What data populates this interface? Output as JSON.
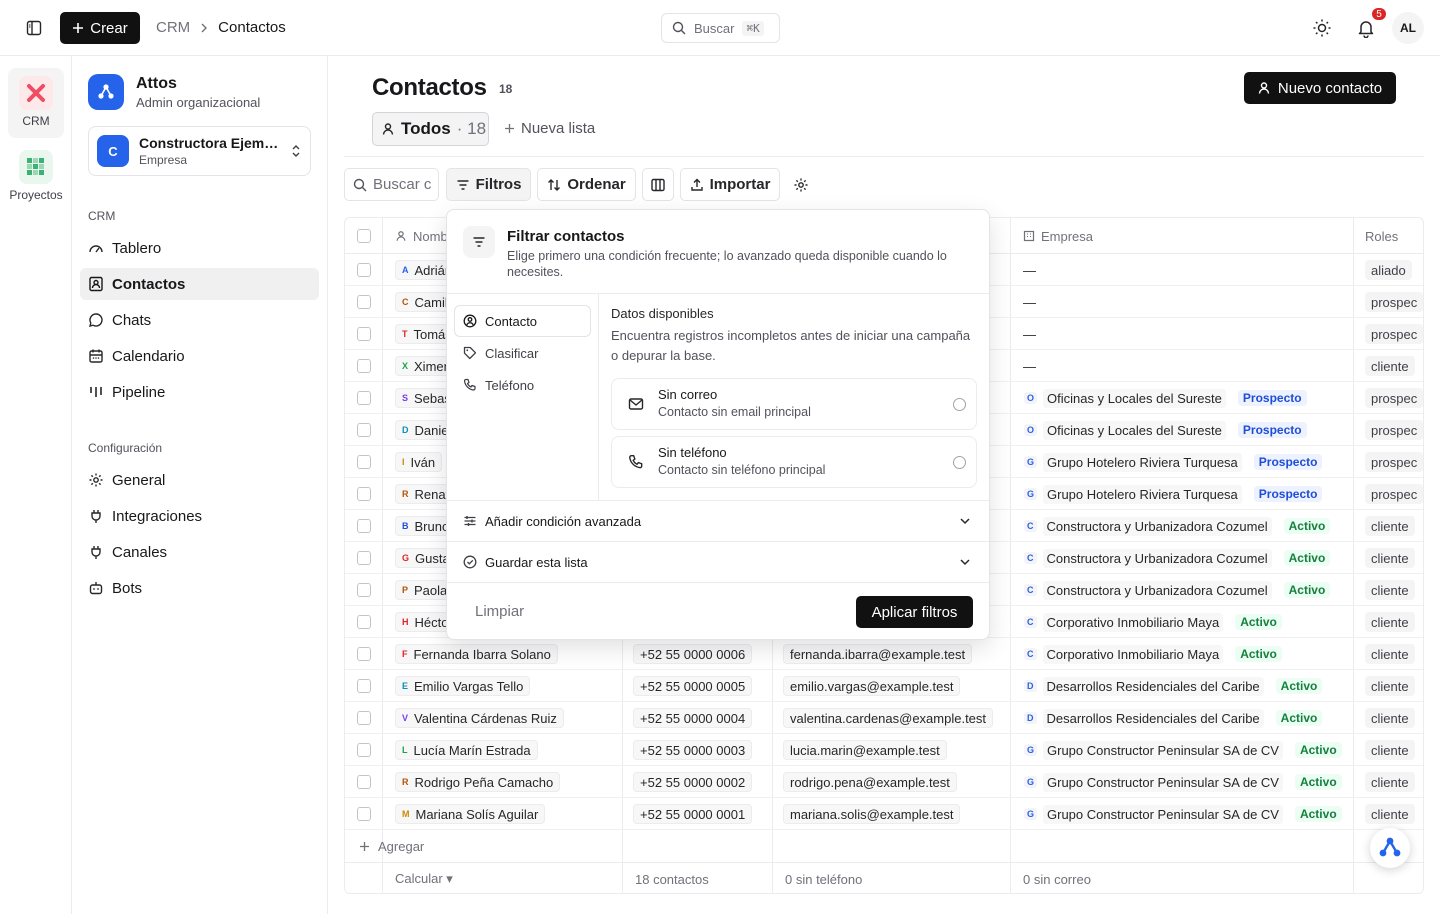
{
  "topbar": {
    "crear_label": "Crear",
    "breadcrumb": [
      "CRM",
      "Contactos"
    ],
    "search_label": "Buscar",
    "search_shortcut": "⌘K",
    "notif_count": "5",
    "user_initials": "AL"
  },
  "rail": [
    {
      "label": "CRM",
      "icon": "crm-x-icon",
      "active": true
    },
    {
      "label": "Proyectos",
      "icon": "grid-icon",
      "active": false
    }
  ],
  "sidebar": {
    "org_name": "Attos",
    "org_role": "Admin organizacional",
    "company_initial": "C",
    "company_name": "Constructora Ejemplo",
    "company_type": "Empresa",
    "section_crm": "CRM",
    "crm_items": [
      {
        "label": "Tablero",
        "icon": "gauge-icon"
      },
      {
        "label": "Contactos",
        "icon": "contacts-icon",
        "active": true
      },
      {
        "label": "Chats",
        "icon": "chat-icon"
      },
      {
        "label": "Calendario",
        "icon": "calendar-icon"
      },
      {
        "label": "Pipeline",
        "icon": "pipeline-icon"
      }
    ],
    "section_config": "Configuración",
    "config_items": [
      {
        "label": "General",
        "icon": "gear-icon"
      },
      {
        "label": "Integraciones",
        "icon": "plug-icon"
      },
      {
        "label": "Canales",
        "icon": "plug-icon"
      },
      {
        "label": "Bots",
        "icon": "bot-icon"
      }
    ]
  },
  "main": {
    "title": "Contactos",
    "count": "18",
    "new_contact_label": "Nuevo contacto",
    "tab_all_label": "Todos",
    "tab_all_count": "· 18",
    "new_list_label": "Nueva lista",
    "search_placeholder": "Buscar c",
    "toolbar": {
      "filters": "Filtros",
      "sort": "Ordenar",
      "import": "Importar"
    }
  },
  "table": {
    "headers": {
      "name": "Nombre",
      "company": "Empresa",
      "roles": "Roles"
    },
    "rows": [
      {
        "initial": "A",
        "name": "Adrián",
        "phone": "",
        "email": "",
        "company_initial": "",
        "company": "—",
        "status": "",
        "role": "aliado",
        "ini_color": "#2563eb"
      },
      {
        "initial": "C",
        "name": "Camila",
        "phone": "",
        "email": "",
        "company_initial": "",
        "company": "—",
        "status": "",
        "role": "prospec",
        "ini_color": "#b45309"
      },
      {
        "initial": "T",
        "name": "Tomás",
        "phone": "",
        "email": "",
        "company_initial": "",
        "company": "—",
        "status": "",
        "role": "prospec",
        "ini_color": "#dc2626"
      },
      {
        "initial": "X",
        "name": "Ximena",
        "phone": "",
        "email": "",
        "company_initial": "",
        "company": "—",
        "status": "",
        "role": "cliente",
        "ini_color": "#16a34a"
      },
      {
        "initial": "S",
        "name": "Sebastián",
        "phone": "",
        "email": "",
        "company_initial": "O",
        "company": "Oficinas y Locales del Sureste",
        "status": "Prospecto",
        "role": "prospec",
        "ini_color": "#7c3aed"
      },
      {
        "initial": "D",
        "name": "Daniela",
        "phone": "",
        "email": "",
        "company_initial": "O",
        "company": "Oficinas y Locales del Sureste",
        "status": "Prospecto",
        "role": "prospec",
        "ini_color": "#0891b2"
      },
      {
        "initial": "I",
        "name": "Iván",
        "phone": "",
        "email": "",
        "company_initial": "G",
        "company": "Grupo Hotelero Riviera Turquesa",
        "status": "Prospecto",
        "role": "prospec",
        "ini_color": "#ca8a04"
      },
      {
        "initial": "R",
        "name": "Renata",
        "phone": "",
        "email": "",
        "company_initial": "G",
        "company": "Grupo Hotelero Riviera Turquesa",
        "status": "Prospecto",
        "role": "prospec",
        "ini_color": "#b45309"
      },
      {
        "initial": "B",
        "name": "Bruno",
        "phone": "",
        "email": "",
        "company_initial": "C",
        "company": "Constructora y Urbanizadora Cozumel",
        "status": "Activo",
        "role": "cliente",
        "ini_color": "#1d4ed8"
      },
      {
        "initial": "G",
        "name": "Gustavo",
        "phone": "",
        "email": "",
        "company_initial": "C",
        "company": "Constructora y Urbanizadora Cozumel",
        "status": "Activo",
        "role": "cliente",
        "ini_color": "#dc2626"
      },
      {
        "initial": "P",
        "name": "Paola",
        "phone": "",
        "email": "",
        "company_initial": "C",
        "company": "Constructora y Urbanizadora Cozumel",
        "status": "Activo",
        "role": "cliente",
        "ini_color": "#b45309"
      },
      {
        "initial": "H",
        "name": "Héctor",
        "phone": "",
        "email": "",
        "company_initial": "C",
        "company": "Corporativo Inmobiliario Maya",
        "status": "Activo",
        "role": "cliente",
        "ini_color": "#dc2626"
      },
      {
        "initial": "F",
        "name": "Fernanda Ibarra Solano",
        "phone": "+52 55 0000 0006",
        "email": "fernanda.ibarra@example.test",
        "company_initial": "C",
        "company": "Corporativo Inmobiliario Maya",
        "status": "Activo",
        "role": "cliente",
        "ini_color": "#dc2626"
      },
      {
        "initial": "E",
        "name": "Emilio Vargas Tello",
        "phone": "+52 55 0000 0005",
        "email": "emilio.vargas@example.test",
        "company_initial": "D",
        "company": "Desarrollos Residenciales del Caribe",
        "status": "Activo",
        "role": "cliente",
        "ini_color": "#0891b2"
      },
      {
        "initial": "V",
        "name": "Valentina Cárdenas Ruiz",
        "phone": "+52 55 0000 0004",
        "email": "valentina.cardenas@example.test",
        "company_initial": "D",
        "company": "Desarrollos Residenciales del Caribe",
        "status": "Activo",
        "role": "cliente",
        "ini_color": "#7c3aed"
      },
      {
        "initial": "L",
        "name": "Lucía Marín Estrada",
        "phone": "+52 55 0000 0003",
        "email": "lucia.marin@example.test",
        "company_initial": "G",
        "company": "Grupo Constructor Peninsular SA de CV",
        "status": "Activo",
        "role": "cliente",
        "ini_color": "#16a34a"
      },
      {
        "initial": "R",
        "name": "Rodrigo Peña Camacho",
        "phone": "+52 55 0000 0002",
        "email": "rodrigo.pena@example.test",
        "company_initial": "G",
        "company": "Grupo Constructor Peninsular SA de CV",
        "status": "Activo",
        "role": "cliente",
        "ini_color": "#b45309"
      },
      {
        "initial": "M",
        "name": "Mariana Solís Aguilar",
        "phone": "+52 55 0000 0001",
        "email": "mariana.solis@example.test",
        "company_initial": "G",
        "company": "Grupo Constructor Peninsular SA de CV",
        "status": "Activo",
        "role": "cliente",
        "ini_color": "#ca8a04"
      }
    ],
    "add_label": "Agregar",
    "footer": {
      "calc": "Calcular ▾",
      "contacts": "18 contactos",
      "no_phone": "0 sin teléfono",
      "no_email": "0 sin correo"
    }
  },
  "popover": {
    "title": "Filtrar contactos",
    "desc": "Elige primero una condición frecuente; lo avanzado queda disponible cuando lo necesites.",
    "tabs": [
      {
        "label": "Contacto",
        "icon": "user-circle-icon",
        "active": true
      },
      {
        "label": "Clasificar",
        "icon": "tag-icon"
      },
      {
        "label": "Teléfono",
        "icon": "phone-icon"
      }
    ],
    "section_title": "Datos disponibles",
    "section_desc": "Encuentra registros incompletos antes de iniciar una campaña o depurar la base.",
    "options": [
      {
        "title": "Sin correo",
        "desc": "Contacto sin email principal",
        "icon": "mail-icon"
      },
      {
        "title": "Sin teléfono",
        "desc": "Contacto sin teléfono principal",
        "icon": "phone-icon"
      }
    ],
    "advanced_label": "Añadir condición avanzada",
    "save_label": "Guardar esta lista",
    "clear_label": "Limpiar",
    "apply_label": "Aplicar filtros"
  },
  "colors": {
    "accent": "#2563eb",
    "primary_button": "#111111",
    "badge": "#dc2626"
  }
}
